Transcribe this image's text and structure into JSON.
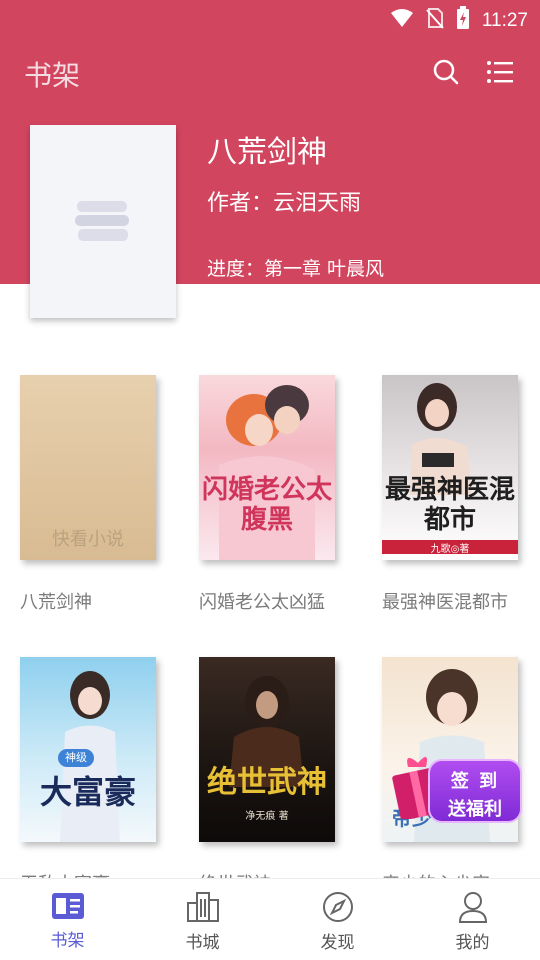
{
  "status_bar": {
    "time": "11:27"
  },
  "app_bar": {
    "title": "书架"
  },
  "current_book": {
    "title": "八荒剑神",
    "author_label": "作者：云泪天雨",
    "progress_label": "进度：第一章 叶晨风"
  },
  "books": [
    {
      "title": "八荒剑神",
      "cover_text": "快看小说"
    },
    {
      "title": "闪婚老公太凶猛",
      "cover_text": "闪婚老公太腹黑"
    },
    {
      "title": "最强神医混都市",
      "cover_text": "最强神医混都市",
      "cover_author": "九歌◎著"
    },
    {
      "title": "无敌大富豪",
      "cover_text": "大富豪",
      "cover_tag": "神级"
    },
    {
      "title": "绝世武神",
      "cover_text": "绝世武神",
      "cover_author": "净无痕 著"
    },
    {
      "title": "帝少的心尖宠",
      "cover_text": "帝少"
    }
  ],
  "sign_badge": {
    "line1": "签 到",
    "line2": "送福利"
  },
  "bottom_nav": [
    {
      "label": "书架",
      "icon": "bookshelf-icon",
      "active": true
    },
    {
      "label": "书城",
      "icon": "city-icon",
      "active": false
    },
    {
      "label": "发现",
      "icon": "compass-icon",
      "active": false
    },
    {
      "label": "我的",
      "icon": "person-icon",
      "active": false
    }
  ],
  "colors": {
    "primary": "#d2455f",
    "nav_active": "#5b5bd6"
  }
}
